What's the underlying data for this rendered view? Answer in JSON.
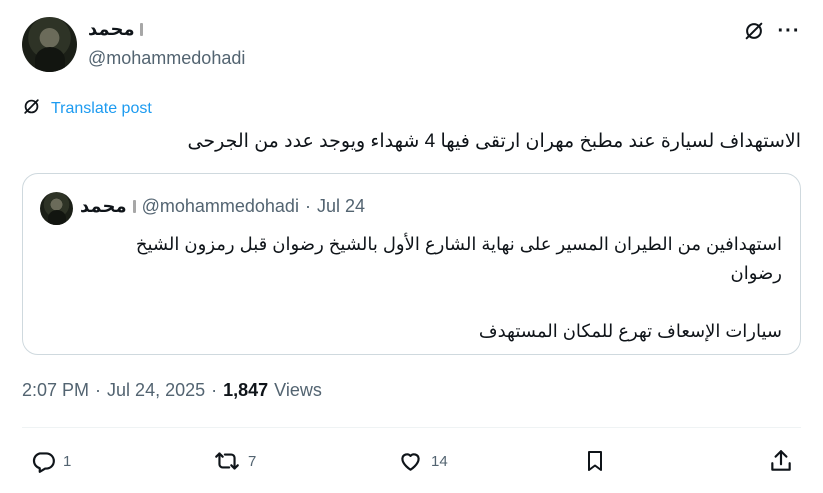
{
  "author": {
    "name": "محمد",
    "handle": "@mohammedohadi"
  },
  "icons": {
    "grok": "grok-icon",
    "more": "more-icon",
    "translate": "translate-icon"
  },
  "more_glyph": "···",
  "translate_label": "Translate post",
  "post_text": "الاستهداف لسيارة عند مطبخ مهران  ارتقى فيها 4 شهداء ويوجد عدد من الجرحى",
  "quote": {
    "name": "محمد",
    "handle": "@mohammedohadi",
    "separator": "·",
    "date": "Jul 24",
    "lines": [
      "استهدافين من الطيران المسير على نهاية الشارع الأول بالشيخ رضوان قبل رمزون الشيخ",
      "رضوان",
      "",
      "سيارات الإسعاف تهرع للمكان المستهدف"
    ]
  },
  "meta": {
    "time": "2:07 PM",
    "sep1": "·",
    "date": "Jul 24, 2025",
    "sep2": "·",
    "views_count": "1,847",
    "views_label": "Views"
  },
  "actions": {
    "replies": "1",
    "reposts": "7",
    "likes": "14"
  },
  "colors": {
    "link": "#1d9bf0",
    "secondary_text": "#536471",
    "border": "#cfd9de"
  }
}
